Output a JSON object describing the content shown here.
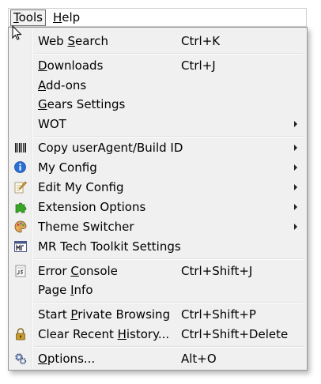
{
  "menubar": {
    "tools": {
      "mnemonic": "T",
      "rest": "ools"
    },
    "help": {
      "mnemonic": "H",
      "rest": "elp"
    }
  },
  "menu": {
    "web_search": {
      "pre": "Web ",
      "u": "S",
      "post": "earch",
      "accel": "Ctrl+K"
    },
    "downloads": {
      "pre": "",
      "u": "D",
      "post": "ownloads",
      "accel": "Ctrl+J"
    },
    "addons": {
      "pre": "",
      "u": "A",
      "post": "dd-ons"
    },
    "gears": {
      "pre": "",
      "u": "G",
      "post": "ears Settings"
    },
    "wot": {
      "label": "WOT"
    },
    "copy_ua": {
      "label": "Copy userAgent/Build ID"
    },
    "my_config": {
      "label": "My Config"
    },
    "edit_my_config": {
      "label": "Edit My Config"
    },
    "extension_options": {
      "label": "Extension Options"
    },
    "theme_switcher": {
      "label": "Theme Switcher"
    },
    "mr_tech": {
      "label": "MR Tech Toolkit Settings"
    },
    "error_console": {
      "pre": "Error ",
      "u": "C",
      "post": "onsole",
      "accel": "Ctrl+Shift+J"
    },
    "page_info": {
      "pre": "Page ",
      "u": "I",
      "post": "nfo"
    },
    "private_browsing": {
      "pre": "Start ",
      "u": "P",
      "post": "rivate Browsing",
      "accel": "Ctrl+Shift+P"
    },
    "clear_history": {
      "pre": "Clear Recent ",
      "u": "H",
      "post": "istory...",
      "accel": "Ctrl+Shift+Delete"
    },
    "options": {
      "pre": "",
      "u": "O",
      "post": "ptions...",
      "accel": "Alt+O"
    }
  },
  "icons": {
    "barcode": "barcode-icon",
    "info": "info-icon",
    "edit": "edit-icon",
    "puzzle": "puzzle-icon",
    "palette": "palette-icon",
    "mr_tech": "mr-tech-icon",
    "console": "console-icon",
    "lock": "lock-icon",
    "options": "gears-icon"
  },
  "colors": {
    "menu_bg": "#f0f0f0",
    "info_blue": "#2a6fd6",
    "puzzle_green": "#3aa628",
    "lock_gold": "#c99a2e"
  }
}
